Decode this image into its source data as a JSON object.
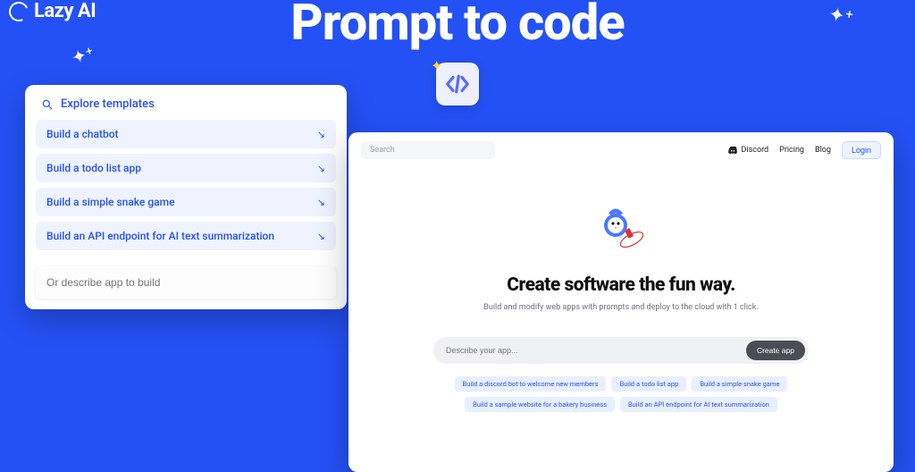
{
  "brand": "Lazy AI",
  "headline": "Prompt to code",
  "templates_card": {
    "header": "Explore templates",
    "items": [
      "Build a chatbot",
      "Build a todo list app",
      "Build a simple snake game",
      "Build an API endpoint for AI text summarization"
    ],
    "describe_placeholder": "Or describe app to build"
  },
  "app": {
    "search_placeholder": "Search",
    "nav": {
      "discord": "Discord",
      "pricing": "Pricing",
      "blog": "Blog",
      "login": "Login"
    },
    "hero_title": "Create software the fun way.",
    "hero_sub": "Build and modify web apps with prompts and deploy to the cloud with 1 click.",
    "prompt_placeholder": "Describe your app...",
    "create_label": "Create app",
    "chips": [
      "Build a discord bot to welcome new members",
      "Build a todo list app",
      "Build a simple snake game",
      "Build a sample website for a bakery business",
      "Build an API endpoint for AI text summarization"
    ]
  }
}
